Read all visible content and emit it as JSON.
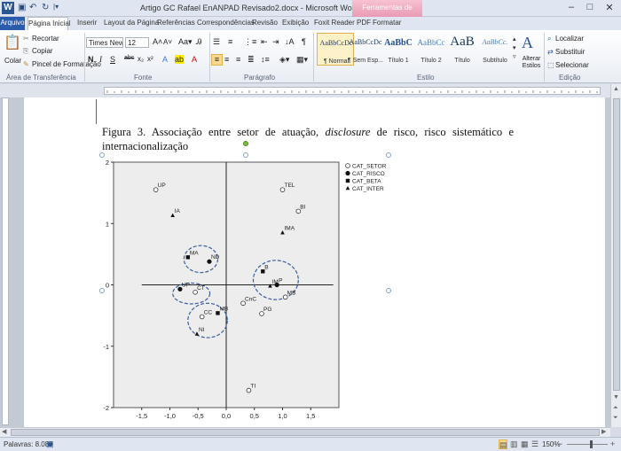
{
  "titlebar": {
    "app_icon": "W",
    "title": "Artigo GC Rafael EnANPAD Revisado2.docx - Microsoft Word",
    "context_tab_group": "Ferramentas de Imagem",
    "minimize": "–",
    "maximize": "□",
    "close": "✕"
  },
  "tabs": [
    {
      "label": "Arquivo",
      "kind": "file"
    },
    {
      "label": "Página Inicial",
      "kind": "active"
    },
    {
      "label": "Inserir"
    },
    {
      "label": "Layout da Página"
    },
    {
      "label": "Referências"
    },
    {
      "label": "Correspondências"
    },
    {
      "label": "Revisão"
    },
    {
      "label": "Exibição"
    },
    {
      "label": "Foxit Reader PDF"
    },
    {
      "label": "Formatar",
      "kind": "context"
    }
  ],
  "ribbon": {
    "clipboard": {
      "paste": "Colar",
      "cut": "Recortar",
      "copy": "Copiar",
      "format_painter": "Pincel de Formatação",
      "group_label": "Área de Transferência"
    },
    "font": {
      "font_name": "Times New Ro",
      "font_size": "12",
      "group_label": "Fonte"
    },
    "paragraph": {
      "group_label": "Parágrafo"
    },
    "styles": {
      "items": [
        {
          "preview": "AaBbCcDc",
          "name": "¶ Normal",
          "selected": true
        },
        {
          "preview": "AaBbCcDc",
          "name": "¶ Sem Esp..."
        },
        {
          "preview": "AaBbC",
          "name": "Título 1"
        },
        {
          "preview": "AaBbCc",
          "name": "Título 2"
        },
        {
          "preview": "AaB",
          "name": "Título"
        },
        {
          "preview": "AaBbCc.",
          "name": "Subtítulo"
        }
      ],
      "change_styles": "Alterar Estilos",
      "group_label": "Estilo"
    },
    "editing": {
      "find": "Localizar",
      "replace": "Substituir",
      "select": "Selecionar",
      "group_label": "Edição"
    }
  },
  "document": {
    "caption_prefix": "Figura 3. Associação entre setor de atuação, ",
    "caption_italic": "disclosure",
    "caption_suffix": " de risco, risco sistemático e internacionalização"
  },
  "chart_data": {
    "type": "scatter",
    "xlim": [
      -2,
      2
    ],
    "ylim": [
      -2,
      2
    ],
    "x_ticks": [
      "-1,5",
      "-1,0",
      "-0,5",
      "0,0",
      "0,5",
      "1,0",
      "1,5"
    ],
    "x_tick_values": [
      -1.5,
      -1.0,
      -0.5,
      0.0,
      0.5,
      1.0,
      1.5
    ],
    "y_ticks": [
      "2",
      "1",
      "0",
      "-1",
      "-2"
    ],
    "y_tick_values": [
      2,
      1,
      0,
      -1,
      -2
    ],
    "legend": [
      {
        "label": "CAT_SETOR",
        "marker": "open-circle"
      },
      {
        "label": "CAT_RISCO",
        "marker": "filled-circle"
      },
      {
        "label": "CAT_BETA",
        "marker": "square"
      },
      {
        "label": "CAT_INTER",
        "marker": "triangle"
      }
    ],
    "legend_position": "right",
    "series": [
      {
        "name": "CAT_SETOR",
        "marker": "open-circle",
        "points": [
          {
            "label": "UP",
            "x": -1.25,
            "y": 1.55
          },
          {
            "label": "TEL",
            "x": 1.0,
            "y": 1.55
          },
          {
            "label": "BI",
            "x": 1.28,
            "y": 1.2
          },
          {
            "label": "CT",
            "x": -0.55,
            "y": -0.12
          },
          {
            "label": "CnC",
            "x": 0.3,
            "y": -0.3
          },
          {
            "label": "MB",
            "x": 1.05,
            "y": -0.2
          },
          {
            "label": "PG",
            "x": 0.63,
            "y": -0.47
          },
          {
            "label": "CC",
            "x": -0.43,
            "y": -0.52
          },
          {
            "label": "TI",
            "x": 0.4,
            "y": -1.72
          }
        ]
      },
      {
        "name": "CAT_RISCO",
        "marker": "filled-circle",
        "points": [
          {
            "label": "ND",
            "x": -0.3,
            "y": 0.38
          },
          {
            "label": "UP",
            "x": -0.82,
            "y": -0.07
          },
          {
            "label": "P",
            "x": 0.9,
            "y": 0.0
          }
        ]
      },
      {
        "name": "CAT_BETA",
        "marker": "square",
        "points": [
          {
            "label": "MA",
            "x": -0.68,
            "y": 0.45
          },
          {
            "label": "B",
            "x": 0.65,
            "y": 0.22
          },
          {
            "label": "MB",
            "x": -0.15,
            "y": -0.46
          }
        ]
      },
      {
        "name": "CAT_INTER",
        "marker": "triangle",
        "points": [
          {
            "label": "IA",
            "x": -0.95,
            "y": 1.13
          },
          {
            "label": "IMA",
            "x": 1.0,
            "y": 0.85
          },
          {
            "label": "IM",
            "x": 0.78,
            "y": -0.02
          },
          {
            "label": "NI",
            "x": -0.52,
            "y": -0.8
          }
        ]
      }
    ],
    "clusters": [
      {
        "cx": -0.45,
        "cy": 0.42,
        "rx": 0.3,
        "ry": 0.22
      },
      {
        "cx": 0.88,
        "cy": 0.08,
        "rx": 0.4,
        "ry": 0.32
      },
      {
        "cx": -0.62,
        "cy": -0.14,
        "rx": 0.33,
        "ry": 0.17
      },
      {
        "cx": -0.33,
        "cy": -0.58,
        "rx": 0.35,
        "ry": 0.28
      }
    ]
  },
  "status": {
    "words": "Palavras: 8.089",
    "zoom": "150%",
    "zoom_minus": "−",
    "zoom_plus": "+"
  }
}
